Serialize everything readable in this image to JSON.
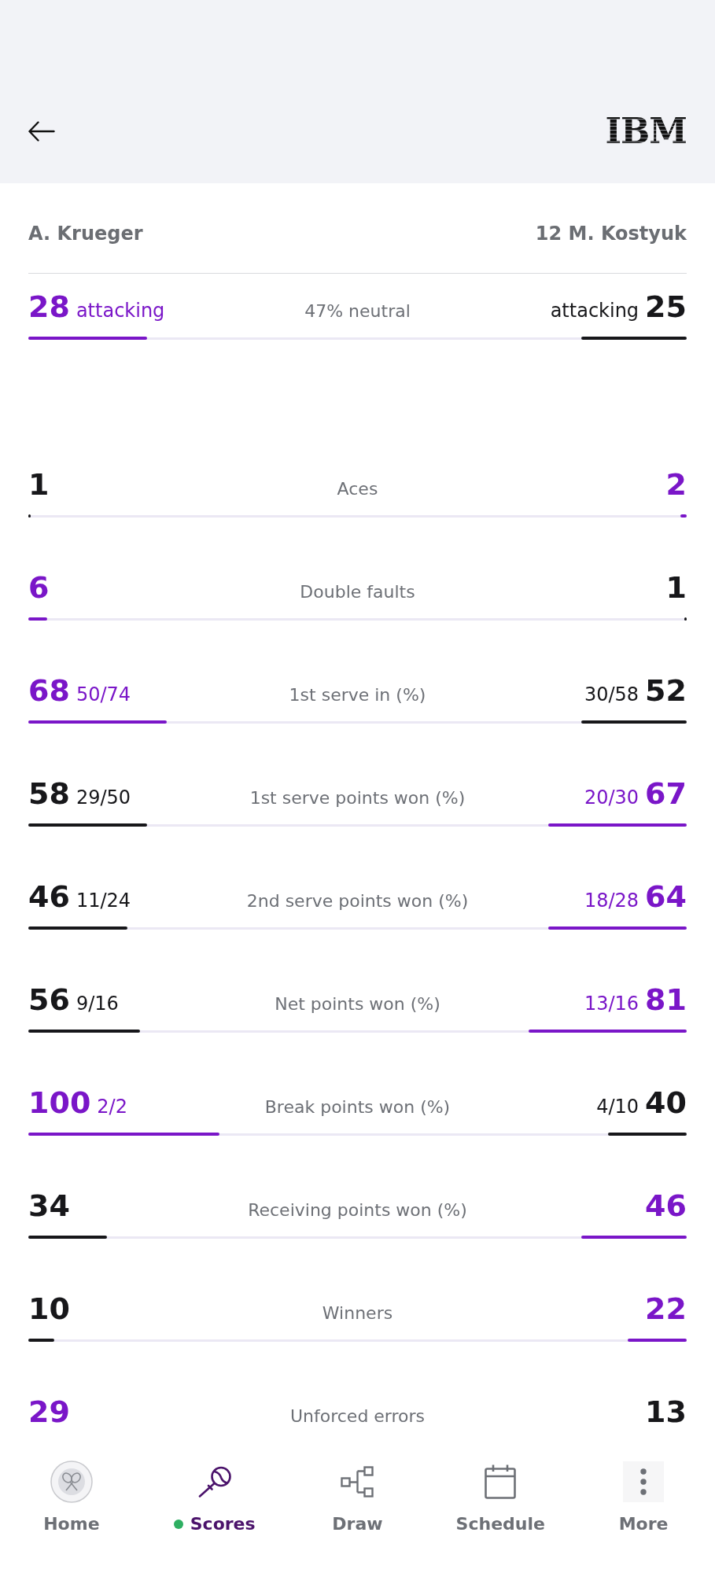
{
  "header": {
    "logo": "IBM"
  },
  "players": [
    {
      "name": "A. Krueger"
    },
    {
      "name": "12 M. Kostyuk"
    }
  ],
  "momentum": {
    "label": "47% neutral",
    "left": {
      "value": "28",
      "detail": "attacking",
      "leading": true,
      "level": 0.18
    },
    "right": {
      "value": "25",
      "detail": "attacking",
      "leading": false,
      "level": 0.16
    }
  },
  "stats": [
    {
      "label": "Aces",
      "left": {
        "value": "1",
        "leading": false,
        "level": 0.004
      },
      "right": {
        "value": "2",
        "leading": true,
        "level": 0.009
      }
    },
    {
      "label": "Double faults",
      "left": {
        "value": "6",
        "leading": true,
        "level": 0.029
      },
      "right": {
        "value": "1",
        "leading": false,
        "level": 0.004
      }
    },
    {
      "label": "1st serve in (%)",
      "left": {
        "value": "68",
        "detail": "50/74",
        "leading": true,
        "level": 0.21
      },
      "right": {
        "value": "52",
        "detail": "30/58",
        "leading": false,
        "level": 0.16
      }
    },
    {
      "label": "1st serve points won (%)",
      "left": {
        "value": "58",
        "detail": "29/50",
        "leading": false,
        "level": 0.18
      },
      "right": {
        "value": "67",
        "detail": "20/30",
        "leading": true,
        "level": 0.21
      }
    },
    {
      "label": "2nd serve points won (%)",
      "left": {
        "value": "46",
        "detail": "11/24",
        "leading": false,
        "level": 0.15
      },
      "right": {
        "value": "64",
        "detail": "18/28",
        "leading": true,
        "level": 0.21
      }
    },
    {
      "label": "Net points won (%)",
      "left": {
        "value": "56",
        "detail": "9/16",
        "leading": false,
        "level": 0.17
      },
      "right": {
        "value": "81",
        "detail": "13/16",
        "leading": true,
        "level": 0.24
      }
    },
    {
      "label": "Break points won (%)",
      "left": {
        "value": "100",
        "detail": "2/2",
        "leading": true,
        "level": 0.29
      },
      "right": {
        "value": "40",
        "detail": "4/10",
        "leading": false,
        "level": 0.12
      }
    },
    {
      "label": "Receiving points won (%)",
      "left": {
        "value": "34",
        "leading": false,
        "level": 0.12
      },
      "right": {
        "value": "46",
        "leading": true,
        "level": 0.16
      }
    },
    {
      "label": "Winners",
      "left": {
        "value": "10",
        "leading": false,
        "level": 0.04
      },
      "right": {
        "value": "22",
        "leading": true,
        "level": 0.09
      }
    },
    {
      "label": "Unforced errors",
      "left": {
        "value": "29",
        "leading": true
      },
      "right": {
        "value": "13",
        "leading": false
      }
    }
  ],
  "nav": [
    {
      "label": "Home",
      "selected": false,
      "live": false
    },
    {
      "label": "Scores",
      "selected": true,
      "live": true
    },
    {
      "label": "Draw",
      "selected": false,
      "live": false
    },
    {
      "label": "Schedule",
      "selected": false,
      "live": false
    },
    {
      "label": "More",
      "selected": false,
      "live": false
    }
  ]
}
